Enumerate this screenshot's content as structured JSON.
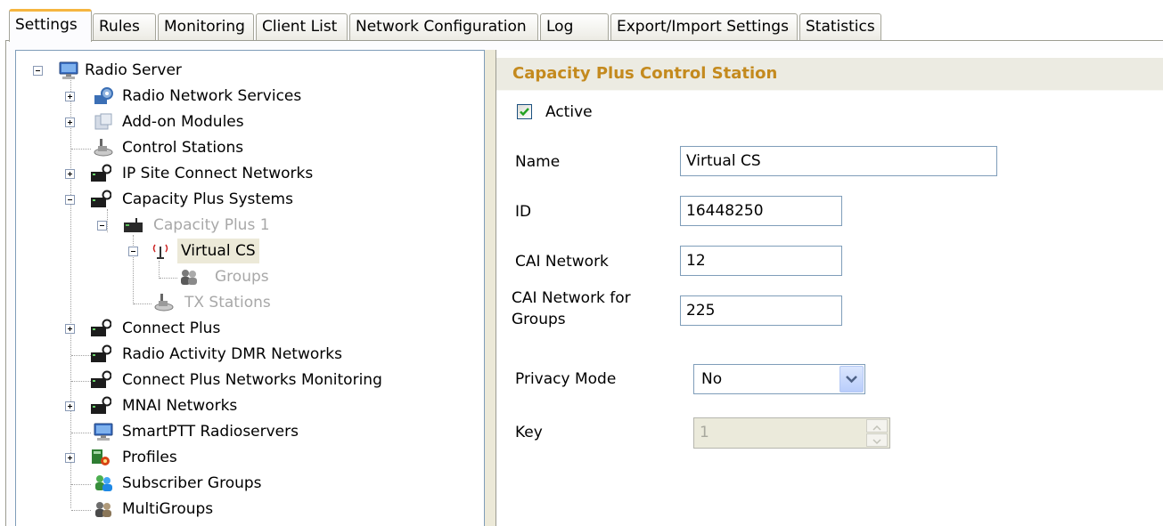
{
  "tabs": [
    {
      "label": "Settings",
      "active": true
    },
    {
      "label": "Rules"
    },
    {
      "label": "Monitoring"
    },
    {
      "label": "Client List"
    },
    {
      "label": "Network Configuration"
    },
    {
      "label": "Log"
    },
    {
      "label": "Export/Import Settings"
    },
    {
      "label": "Statistics"
    }
  ],
  "tree": {
    "items": [
      {
        "label": "Radio Server",
        "icon": "monitor-icon",
        "expander": "minus"
      },
      {
        "label": "Radio Network Services",
        "icon": "gear-services-icon",
        "expander": "plus"
      },
      {
        "label": "Add-on Modules",
        "icon": "puzzle-icon",
        "expander": "plus"
      },
      {
        "label": "Control Stations",
        "icon": "radio-station-icon"
      },
      {
        "label": "IP Site Connect Networks",
        "icon": "network-repeater-icon",
        "expander": "plus"
      },
      {
        "label": "Capacity Plus Systems",
        "icon": "network-repeater-icon",
        "expander": "minus"
      },
      {
        "label": "Capacity Plus 1",
        "icon": "repeater-icon",
        "expander": "minus",
        "disabled": true
      },
      {
        "label": "Virtual CS",
        "icon": "antenna-icon",
        "expander": "minus",
        "selected": true
      },
      {
        "label": "Groups",
        "icon": "group-icon",
        "disabled": true
      },
      {
        "label": "TX Stations",
        "icon": "radio-station-icon",
        "disabled": true
      },
      {
        "label": "Connect Plus",
        "icon": "network-repeater-icon",
        "expander": "plus"
      },
      {
        "label": "Radio Activity DMR Networks",
        "icon": "network-repeater-icon"
      },
      {
        "label": "Connect Plus Networks Monitoring",
        "icon": "network-repeater-icon"
      },
      {
        "label": "MNAI Networks",
        "icon": "network-repeater-icon",
        "expander": "plus"
      },
      {
        "label": "SmartPTT Radioservers",
        "icon": "monitor-icon"
      },
      {
        "label": "Profiles",
        "icon": "profiles-icon",
        "expander": "plus"
      },
      {
        "label": "Subscriber Groups",
        "icon": "subscriber-groups-icon"
      },
      {
        "label": "MultiGroups",
        "icon": "group-icon"
      }
    ]
  },
  "panel": {
    "title": "Capacity Plus Control Station",
    "active_label": "Active",
    "active_checked": true,
    "name_label": "Name",
    "name_value": "Virtual CS",
    "id_label": "ID",
    "id_value": "16448250",
    "cai_label": "CAI Network",
    "cai_value": "12",
    "cai_groups_label_1": "CAI Network for",
    "cai_groups_label_2": "Groups",
    "cai_groups_value": "225",
    "privacy_label": "Privacy Mode",
    "privacy_value": "No",
    "key_label": "Key",
    "key_value": "1"
  },
  "colors": {
    "accent_tab": "#f5b540",
    "panel_title": "#c48a1e",
    "check": "#21a121"
  }
}
